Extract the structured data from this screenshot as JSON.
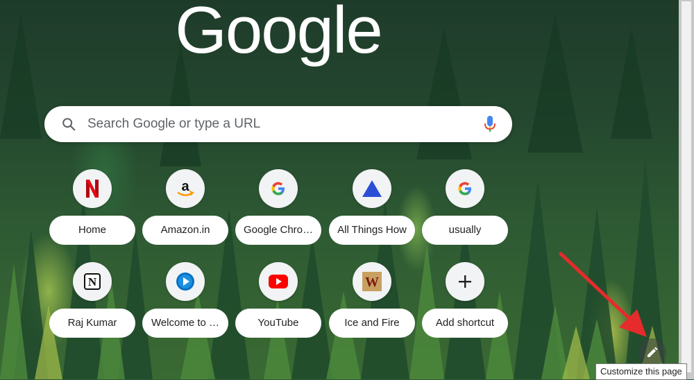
{
  "logo_text": "Google",
  "search": {
    "placeholder": "Search Google or type a URL",
    "search_icon": "search-icon",
    "mic_icon": "mic-icon"
  },
  "shortcuts": [
    {
      "label": "Home",
      "icon": "netflix-icon"
    },
    {
      "label": "Amazon.in",
      "icon": "amazon-icon"
    },
    {
      "label": "Google Chro…",
      "icon": "google-icon"
    },
    {
      "label": "All Things How",
      "icon": "allthingshow-icon"
    },
    {
      "label": "usually",
      "icon": "google-icon"
    },
    {
      "label": "Raj Kumar",
      "icon": "notion-icon"
    },
    {
      "label": "Welcome to …",
      "icon": "play-icon"
    },
    {
      "label": "YouTube",
      "icon": "youtube-icon"
    },
    {
      "label": "Ice and Fire",
      "icon": "ice-and-fire-icon"
    },
    {
      "label": "Add shortcut",
      "icon": "plus-icon"
    }
  ],
  "customize": {
    "tooltip": "Customize this page",
    "icon": "pencil-icon"
  },
  "colors": {
    "accent_arrow": "#e52b2b",
    "google_blue": "#4285F4",
    "google_red": "#EA4335",
    "google_yellow": "#FBBC05",
    "google_green": "#34A853"
  }
}
